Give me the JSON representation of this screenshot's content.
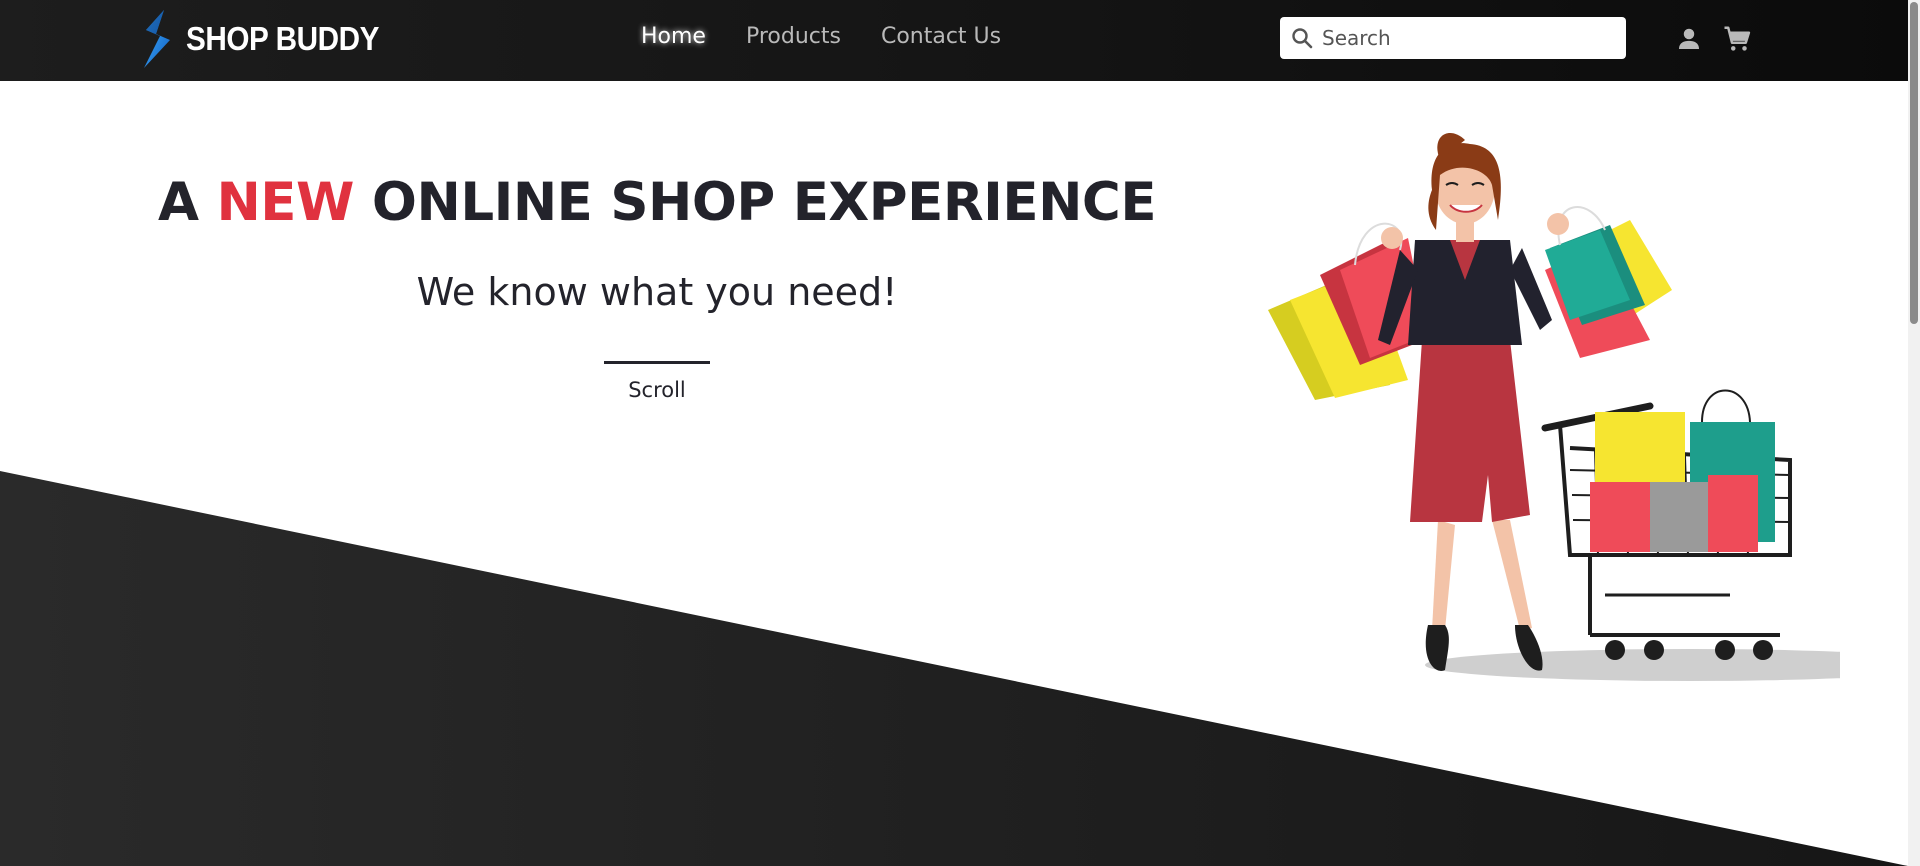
{
  "brand": {
    "name": "SHOP BUDDY",
    "logo_icon": "lightning-s-logo"
  },
  "nav": {
    "links": [
      {
        "label": "Home",
        "active": true
      },
      {
        "label": "Products",
        "active": false
      },
      {
        "label": "Contact Us",
        "active": false
      }
    ]
  },
  "search": {
    "placeholder": "Search",
    "value": "",
    "icon": "search-icon"
  },
  "header_icons": {
    "user": "user-icon",
    "cart": "cart-icon"
  },
  "hero": {
    "headline_prefix": "A ",
    "headline_accent": "NEW",
    "headline_suffix": " ONLINE SHOP EXPERIENCE",
    "subheading": "We know what you need!",
    "scroll_label": "Scroll",
    "illustration": "woman-with-shopping-bags-and-cart"
  },
  "colors": {
    "navbar": "#141414",
    "accent": "#e0323f",
    "text_dark": "#23232b",
    "hero_dark": "#252525",
    "logo_blue": "#1e90e6"
  }
}
